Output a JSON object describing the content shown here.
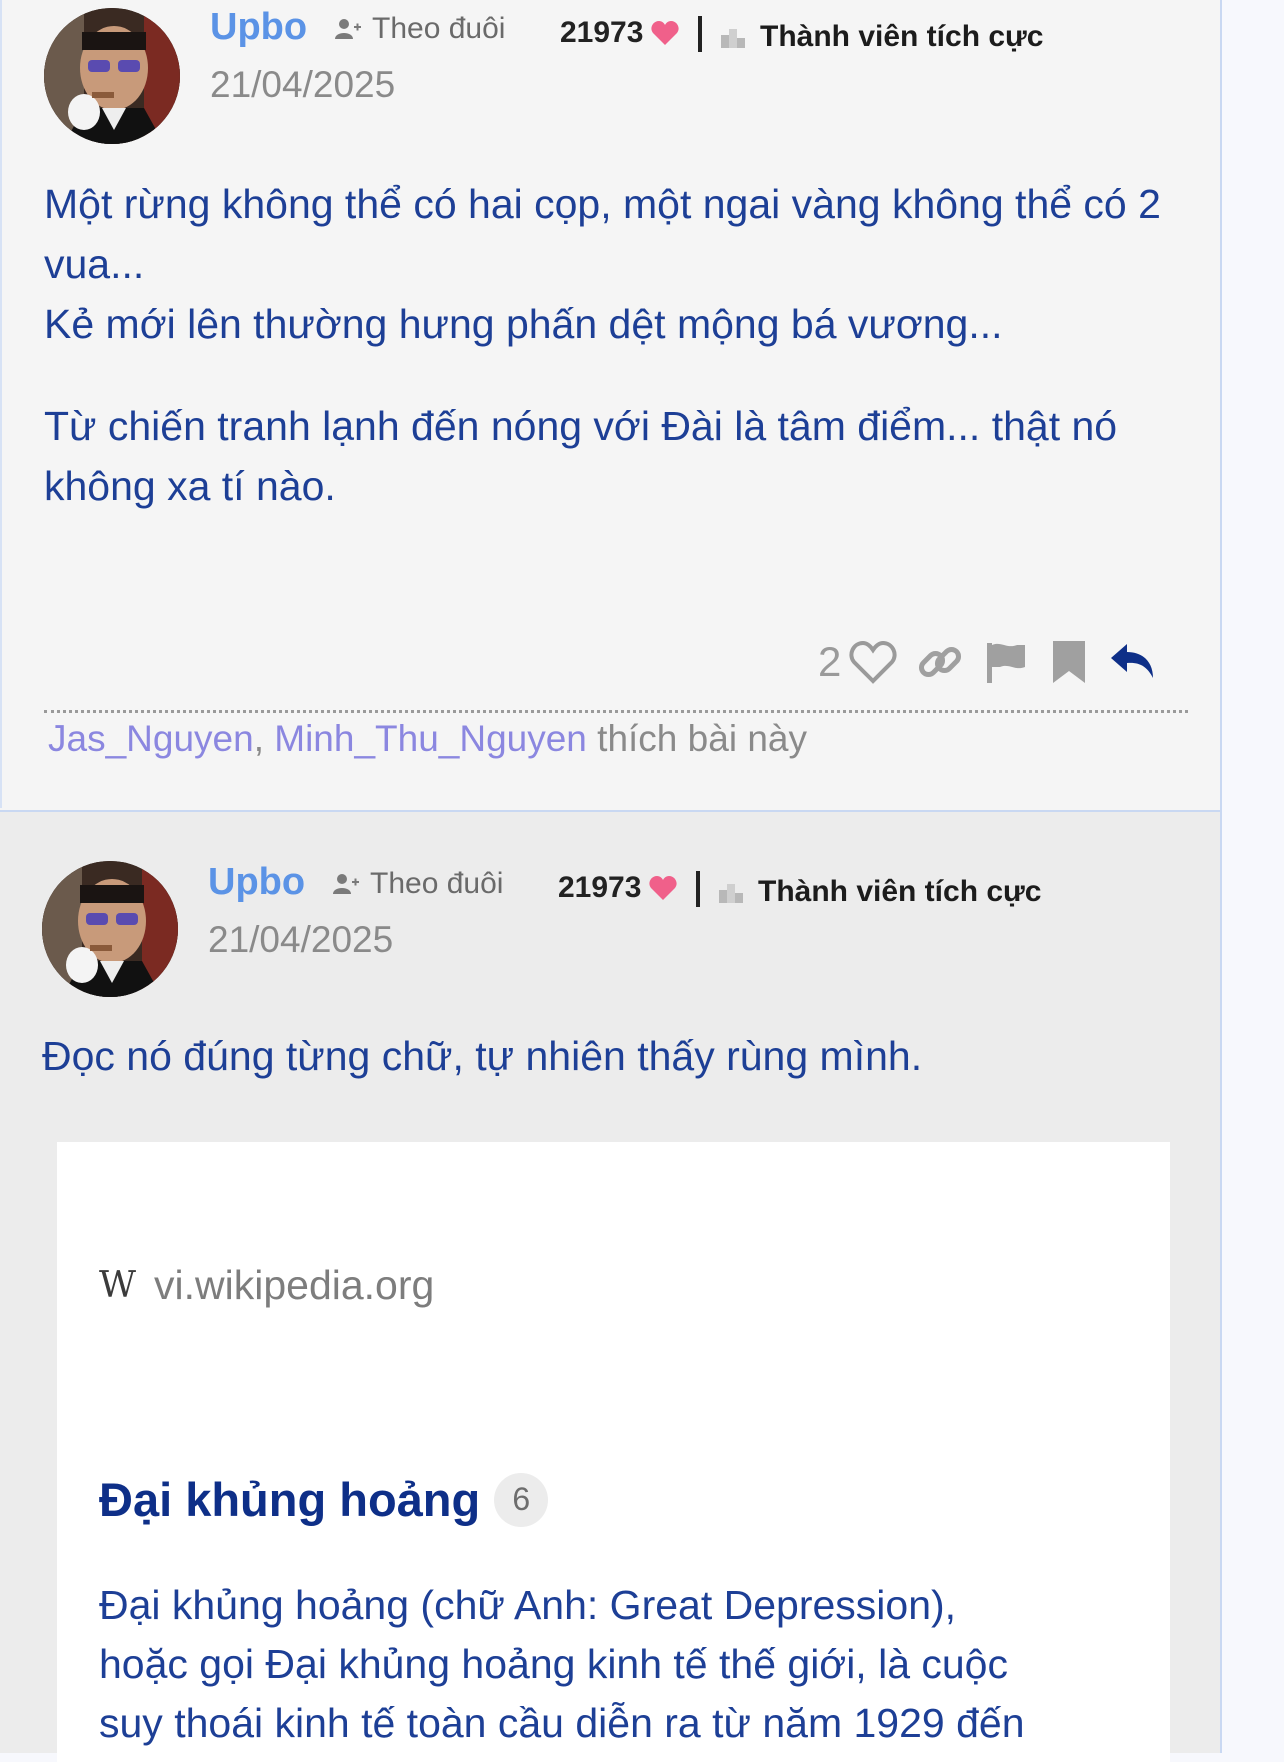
{
  "posts": [
    {
      "author": "Upbo",
      "follow_label": "Theo đuôi",
      "points": "21973",
      "rank": "Thành viên tích cực",
      "date": "21/04/2025",
      "body": [
        "Một rừng không thể có hai cọp, một ngai vàng không thể có 2 vua...",
        "Kẻ mới lên thường hưng phấn dệt mộng bá vương...",
        "Từ chiến tranh lạnh đến nóng với Đài là tâm điểm... thật nó không xa tí nào."
      ],
      "like_count": "2",
      "liked_by": [
        "Jas_Nguyen",
        "Minh_Thu_Nguyen"
      ],
      "liked_suffix": "thích bài này"
    },
    {
      "author": "Upbo",
      "follow_label": "Theo đuôi",
      "points": "21973",
      "rank": "Thành viên tích cực",
      "date": "21/04/2025",
      "body": "Đọc nó đúng từng chữ, tự nhiên thấy rùng mình.",
      "link_card": {
        "source": "vi.wikipedia.org",
        "source_icon": "W",
        "title": "Đại khủng hoảng",
        "badge": "6",
        "description": [
          "Đại khủng hoảng (chữ Anh: Great Depression),",
          "hoặc gọi Đại khủng hoảng kinh tế thế giới, là cuộc",
          "suy thoái kinh tế toàn cầu diễn ra từ năm 1929 đến"
        ]
      }
    }
  ],
  "colors": {
    "author": "#5b93e6",
    "body_text": "#1d3f96",
    "heart": "#f0608a",
    "liker": "#8b87e0",
    "reply": "#0e2f88"
  }
}
